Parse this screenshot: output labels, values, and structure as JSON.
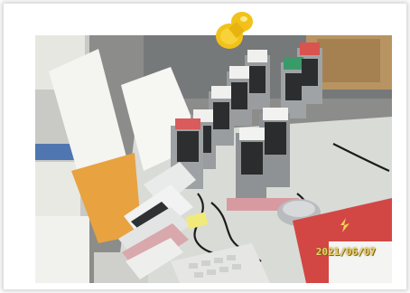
{
  "photo": {
    "date_stamp": "2021/06/07",
    "accent_colors": {
      "pin": "#f2c21a",
      "cradle": "#9a9d9f",
      "book": "#d24744",
      "folder": "#e8a240"
    }
  }
}
